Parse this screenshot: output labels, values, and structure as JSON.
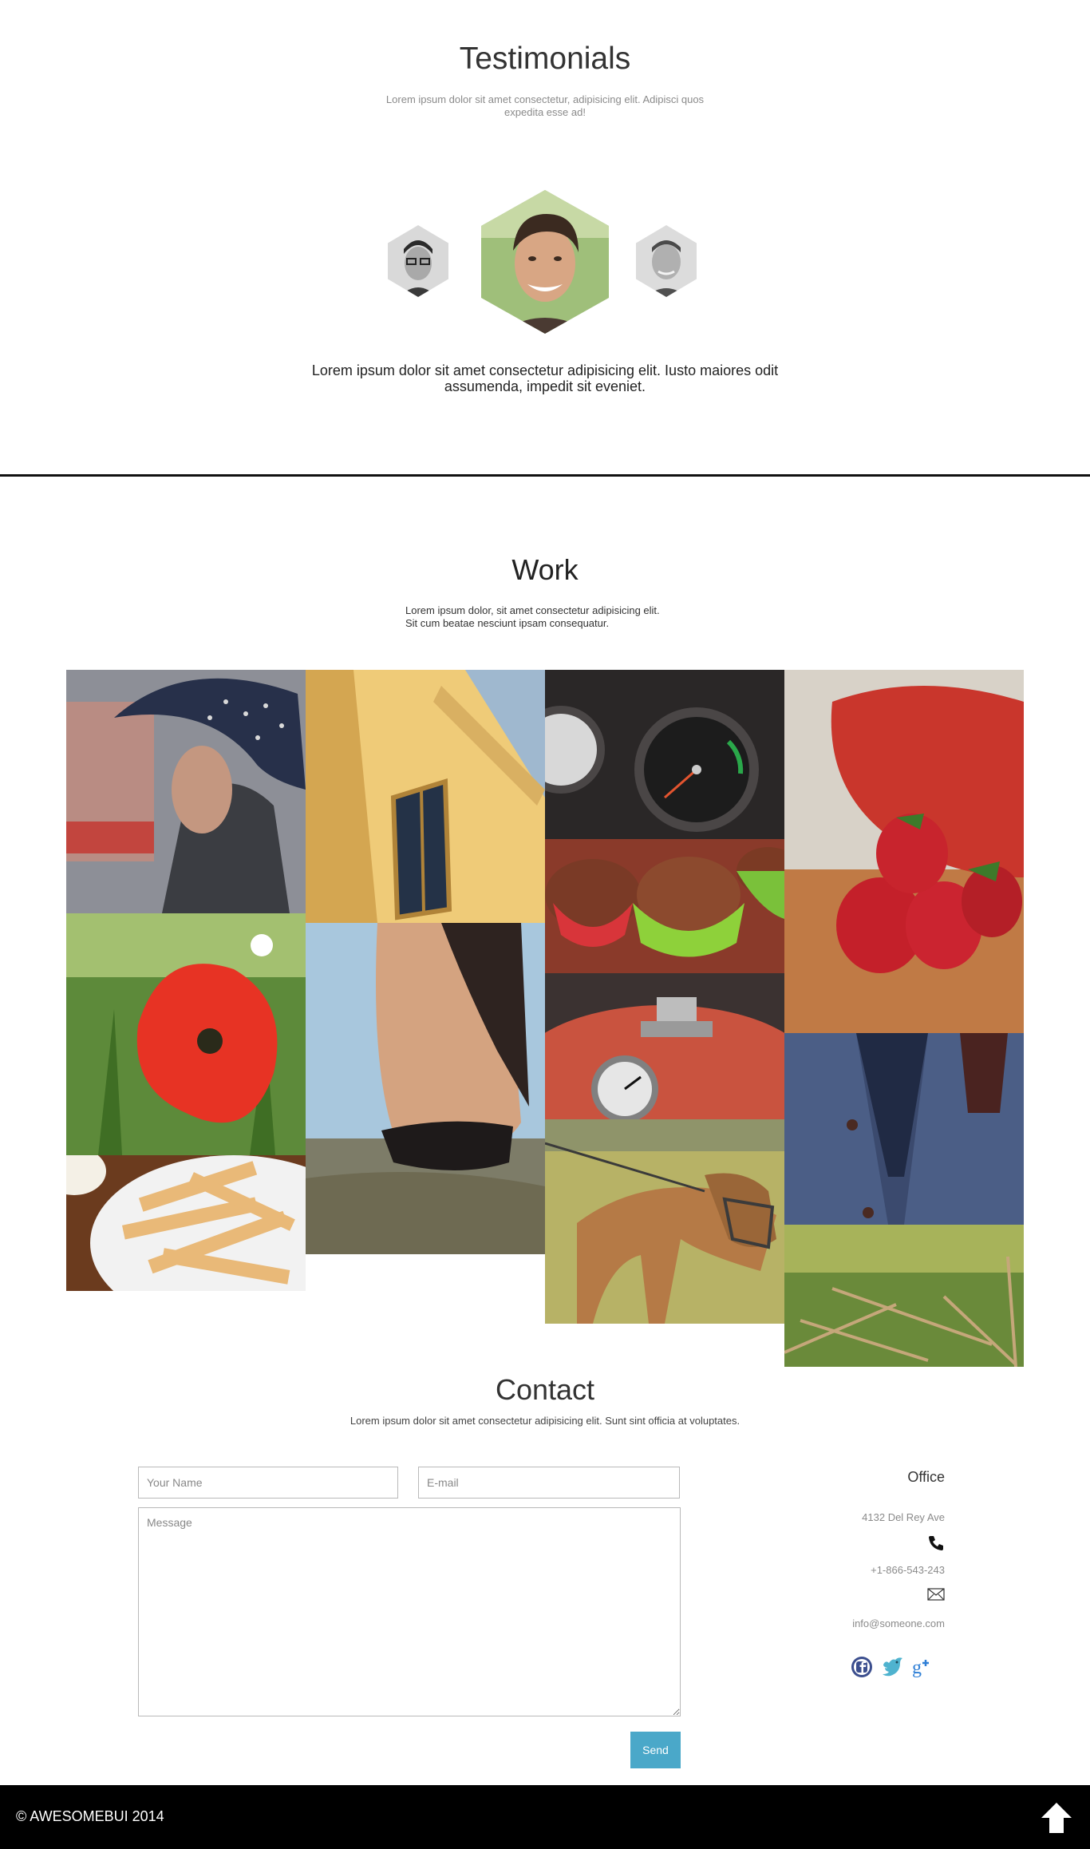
{
  "testimonials": {
    "title": "Testimonials",
    "subtitle": "Lorem ipsum dolor sit amet consectetur, adipisicing elit. Adipisci quos expedita esse ad!",
    "quote": "Lorem ipsum dolor sit amet consectetur adipisicing elit. Iusto maiores odit assumenda, impedit sit eveniet."
  },
  "work": {
    "title": "Work",
    "subtitle_line1": "Lorem ipsum dolor, sit amet consectetur adipisicing elit.",
    "subtitle_line2": "Sit cum beatae nesciunt ipsam consequatur."
  },
  "contact": {
    "title": "Contact",
    "subtitle": "Lorem ipsum dolor sit amet consectetur adipisicing elit. Sunt sint officia at voluptates.",
    "name_placeholder": "Your Name",
    "email_placeholder": "E-mail",
    "message_placeholder": "Message",
    "send_label": "Send",
    "office": {
      "title": "Office",
      "address": "4132 Del Rey Ave",
      "phone": "+1-866-543-243",
      "email": "info@someone.com"
    },
    "social": [
      "facebook-icon",
      "twitter-icon",
      "google-plus-icon"
    ]
  },
  "footer": {
    "copyright": "© AWESOMEBUI 2014"
  },
  "colors": {
    "accent": "#4aa8c9",
    "footer_bg": "#000000",
    "divider": "#111111"
  }
}
